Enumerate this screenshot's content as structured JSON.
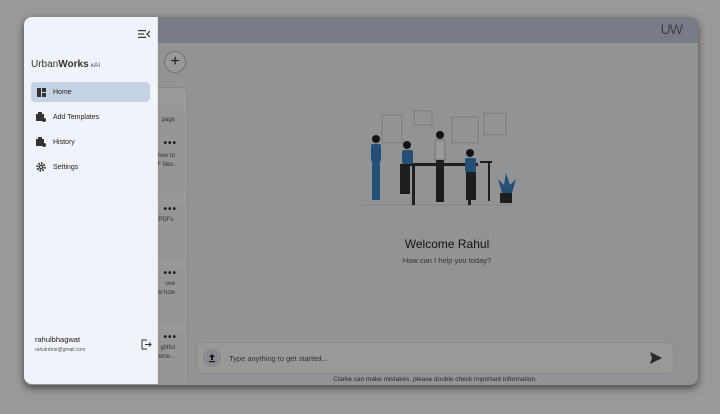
{
  "header": {
    "brand_mark": "UW"
  },
  "drawer": {
    "brand": {
      "urban": "Urban",
      "works": "Works",
      "xai": "xAI"
    },
    "nav": [
      {
        "label": "Home",
        "icon": "dashboard-icon",
        "active": true
      },
      {
        "label": "Add Templates",
        "icon": "template-add-icon",
        "active": false
      },
      {
        "label": "History",
        "icon": "history-icon",
        "active": false
      },
      {
        "label": "Settings",
        "icon": "gear-icon",
        "active": false
      }
    ],
    "user": {
      "name": "rahulbhagwat",
      "email": "rahulrdme@gmail.com"
    }
  },
  "conversations": [
    {
      "text": "page"
    },
    {
      "text": "how to\nF files."
    },
    {
      "text": "o PDFs."
    },
    {
      "text": "ove\nw how"
    },
    {
      "text": "ghtful\nretrie..."
    }
  ],
  "main": {
    "welcome_title": "Welcome Rahul",
    "welcome_sub": "How can I help you today?",
    "input_placeholder": "Type anything to get started...",
    "disclaimer": "Clarke can make mistakes, please double check important information."
  },
  "colors": {
    "topbar": "#c8cfe0",
    "drawer_bg": "#f1f3fa",
    "active_nav": "#c6d3e4",
    "illustration_accent": "#3c85c8"
  }
}
